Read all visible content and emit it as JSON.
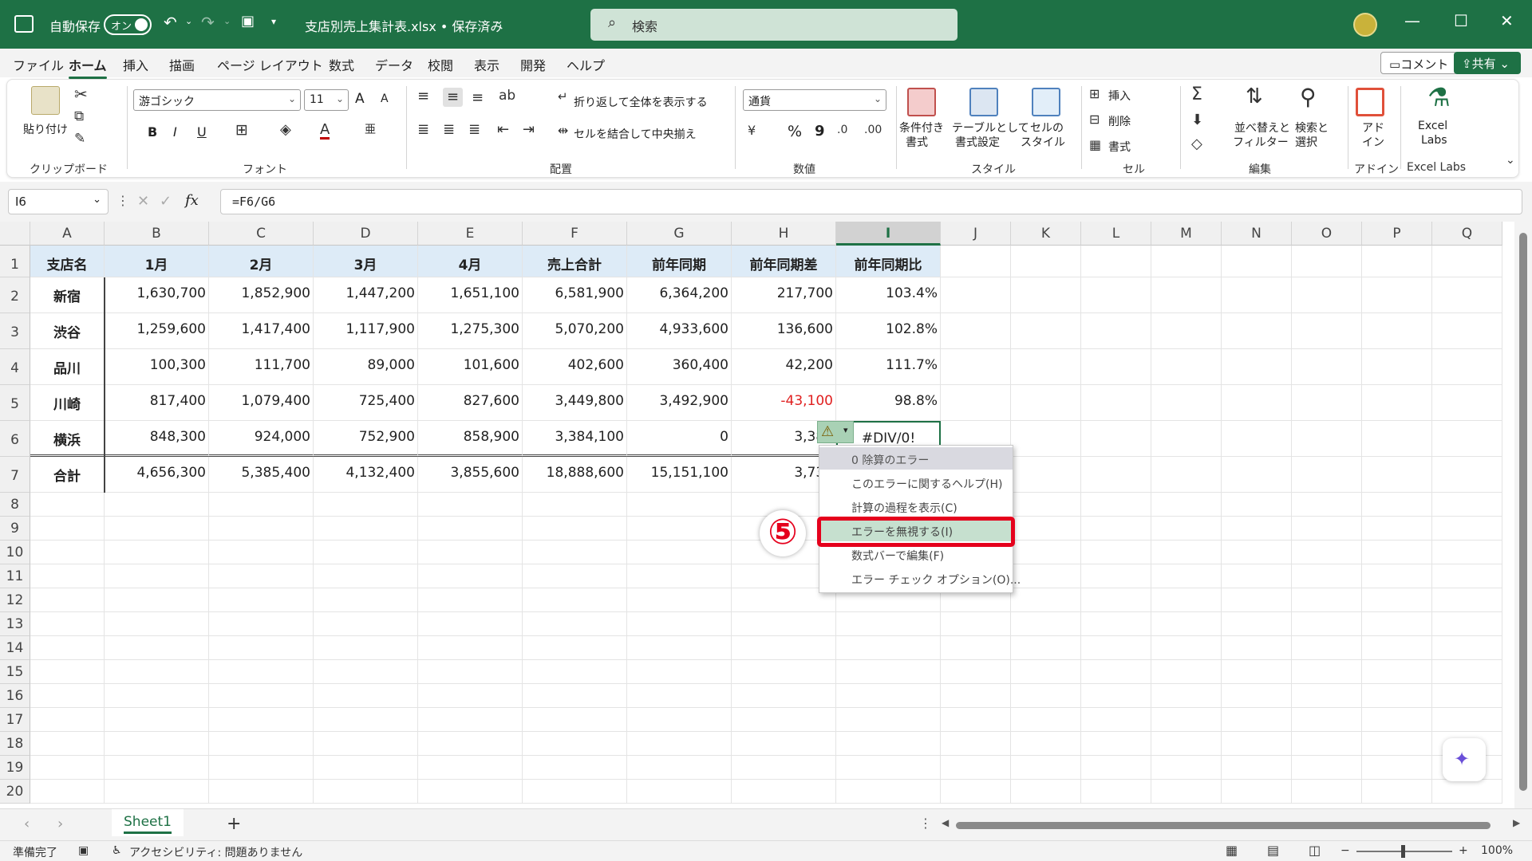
{
  "titlebar": {
    "autosave_label": "自動保存",
    "autosave_state": "オン",
    "document_title": "支店別売上集計表.xlsx • 保存済み",
    "search_placeholder": "検索",
    "accent": "#1e7145"
  },
  "menu": {
    "tabs": [
      "ファイル",
      "ホーム",
      "挿入",
      "描画",
      "ページ レイアウト",
      "数式",
      "データ",
      "校閲",
      "表示",
      "開発",
      "ヘルプ"
    ],
    "active": "ホーム",
    "comment_button": "コメント",
    "share_button": "共有"
  },
  "ribbon": {
    "clipboard": {
      "paste": "貼り付け",
      "group": "クリップボード"
    },
    "font": {
      "name": "游ゴシック",
      "size": "11",
      "bold": "B",
      "italic": "I",
      "underline": "U",
      "grow": "A",
      "shrink": "A",
      "group": "フォント"
    },
    "alignment": {
      "wrap": "折り返して全体を表示する",
      "merge": "セルを結合して中央揃え",
      "group": "配置"
    },
    "number": {
      "format": "通貨",
      "percent": "%",
      "comma": "9",
      "group": "数値"
    },
    "styles": {
      "conditional_1": "条件付き",
      "conditional_2": "書式",
      "table_1": "テーブルとして",
      "table_2": "書式設定",
      "cellstyle_1": "セルの",
      "cellstyle_2": "スタイル",
      "group": "スタイル"
    },
    "cells": {
      "insert": "挿入",
      "delete": "削除",
      "format": "書式",
      "group": "セル"
    },
    "editing": {
      "sort_1": "並べ替えと",
      "sort_2": "フィルター",
      "find_1": "検索と",
      "find_2": "選択",
      "group": "編集"
    },
    "addins": {
      "label_1": "アド",
      "label_2": "イン",
      "group": "アドイン"
    },
    "excellabs": {
      "label_1": "Excel",
      "label_2": "Labs",
      "group": "Excel Labs"
    }
  },
  "formula_bar": {
    "cell_ref": "I6",
    "fx": "fx",
    "formula": "=F6/G6"
  },
  "sheet": {
    "columns": [
      "A",
      "B",
      "C",
      "D",
      "E",
      "F",
      "G",
      "H",
      "I",
      "J",
      "K",
      "L",
      "M",
      "N",
      "O",
      "P",
      "Q"
    ],
    "selected_column": "I",
    "row_numbers": [
      "1",
      "2",
      "3",
      "4",
      "5",
      "6",
      "7",
      "8",
      "9",
      "10",
      "11",
      "12",
      "13",
      "14",
      "15",
      "16",
      "17",
      "18",
      "19",
      "20"
    ],
    "headers": [
      "支店名",
      "1月",
      "2月",
      "3月",
      "4月",
      "売上合計",
      "前年同期",
      "前年同期差",
      "前年同期比"
    ],
    "rows": [
      [
        "新宿",
        "1,630,700",
        "1,852,900",
        "1,447,200",
        "1,651,100",
        "6,581,900",
        "6,364,200",
        "217,700",
        "103.4%"
      ],
      [
        "渋谷",
        "1,259,600",
        "1,417,400",
        "1,117,900",
        "1,275,300",
        "5,070,200",
        "4,933,600",
        "136,600",
        "102.8%"
      ],
      [
        "品川",
        "100,300",
        "111,700",
        "89,000",
        "101,600",
        "402,600",
        "360,400",
        "42,200",
        "111.7%"
      ],
      [
        "川崎",
        "817,400",
        "1,079,400",
        "725,400",
        "827,600",
        "3,449,800",
        "3,492,900",
        "-43,100",
        "98.8%"
      ],
      [
        "横浜",
        "848,300",
        "924,000",
        "752,900",
        "858,900",
        "3,384,100",
        "0",
        "3,384",
        "#DIV/0!"
      ],
      [
        "合計",
        "4,656,300",
        "5,385,400",
        "4,132,400",
        "3,855,600",
        "18,888,600",
        "15,151,100",
        "3,737",
        ""
      ]
    ],
    "negative_color": "#e02020",
    "header_fill": "#ddebf7"
  },
  "error_menu": {
    "title": "0 除算のエラー",
    "items": [
      "このエラーに関するヘルプ(H)",
      "計算の過程を表示(C)",
      "エラーを無視する(I)",
      "数式バーで編集(F)",
      "エラー チェック オプション(O)..."
    ],
    "highlighted": "エラーを無視する(I)"
  },
  "annotation": {
    "step": "⑤",
    "color": "#e5001c"
  },
  "sheet_tabs": {
    "active": "Sheet1",
    "add": "+"
  },
  "statusbar": {
    "ready": "準備完了",
    "accessibility": "アクセシビリティ: 問題ありません",
    "zoom": "100%"
  }
}
